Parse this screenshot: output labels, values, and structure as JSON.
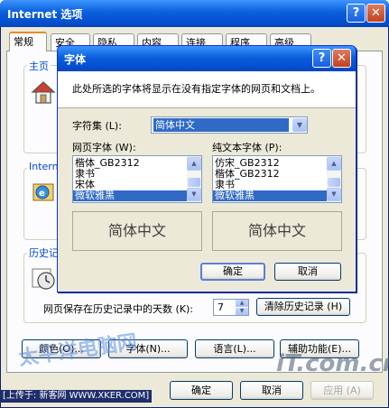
{
  "outer": {
    "title": "Internet 选项",
    "tabs": [
      "常规",
      "安全",
      "隐私",
      "内容",
      "连接",
      "程序",
      "高级"
    ],
    "groups": {
      "home_label": "主页",
      "temp_label": "Intern",
      "history_label": "历史记"
    },
    "history_days_label": "网页保存在历史记录中的天数 (K):",
    "history_days_value": "7",
    "clear_history_button": "清除历史记录 (H)",
    "buttons": {
      "colors": "颜色(O)...",
      "fonts": "字体(N)...",
      "languages": "语言(L)...",
      "accessibility": "辅助功能(E)..."
    },
    "ok": "确定",
    "cancel": "取消",
    "apply": "应用 (A)"
  },
  "font_dialog": {
    "title": "字体",
    "info": "此处所选的字体将显示在没有指定字体的网页和文档上。",
    "charset_label": "字符集 (L):",
    "charset_value": "简体中文",
    "web_font_label": "网页字体 (W):",
    "web_fonts": [
      "楷体_GB2312",
      "隶书",
      "宋体",
      "微软雅黑"
    ],
    "web_font_selected": 3,
    "plain_font_label": "纯文本字体 (P):",
    "plain_fonts": [
      "仿宋_GB2312",
      "楷体_GB2312",
      "隶书",
      "微软雅黑"
    ],
    "plain_font_selected": 3,
    "preview_web": "简体中文",
    "preview_plain": "简体中文",
    "ok": "确定",
    "cancel": "取消"
  },
  "watermarks": {
    "left": "太平洋电脑网",
    "right": "iT.com.cn"
  },
  "status_text": "[上传于: 新客网 WWW.XKER.COM]"
}
